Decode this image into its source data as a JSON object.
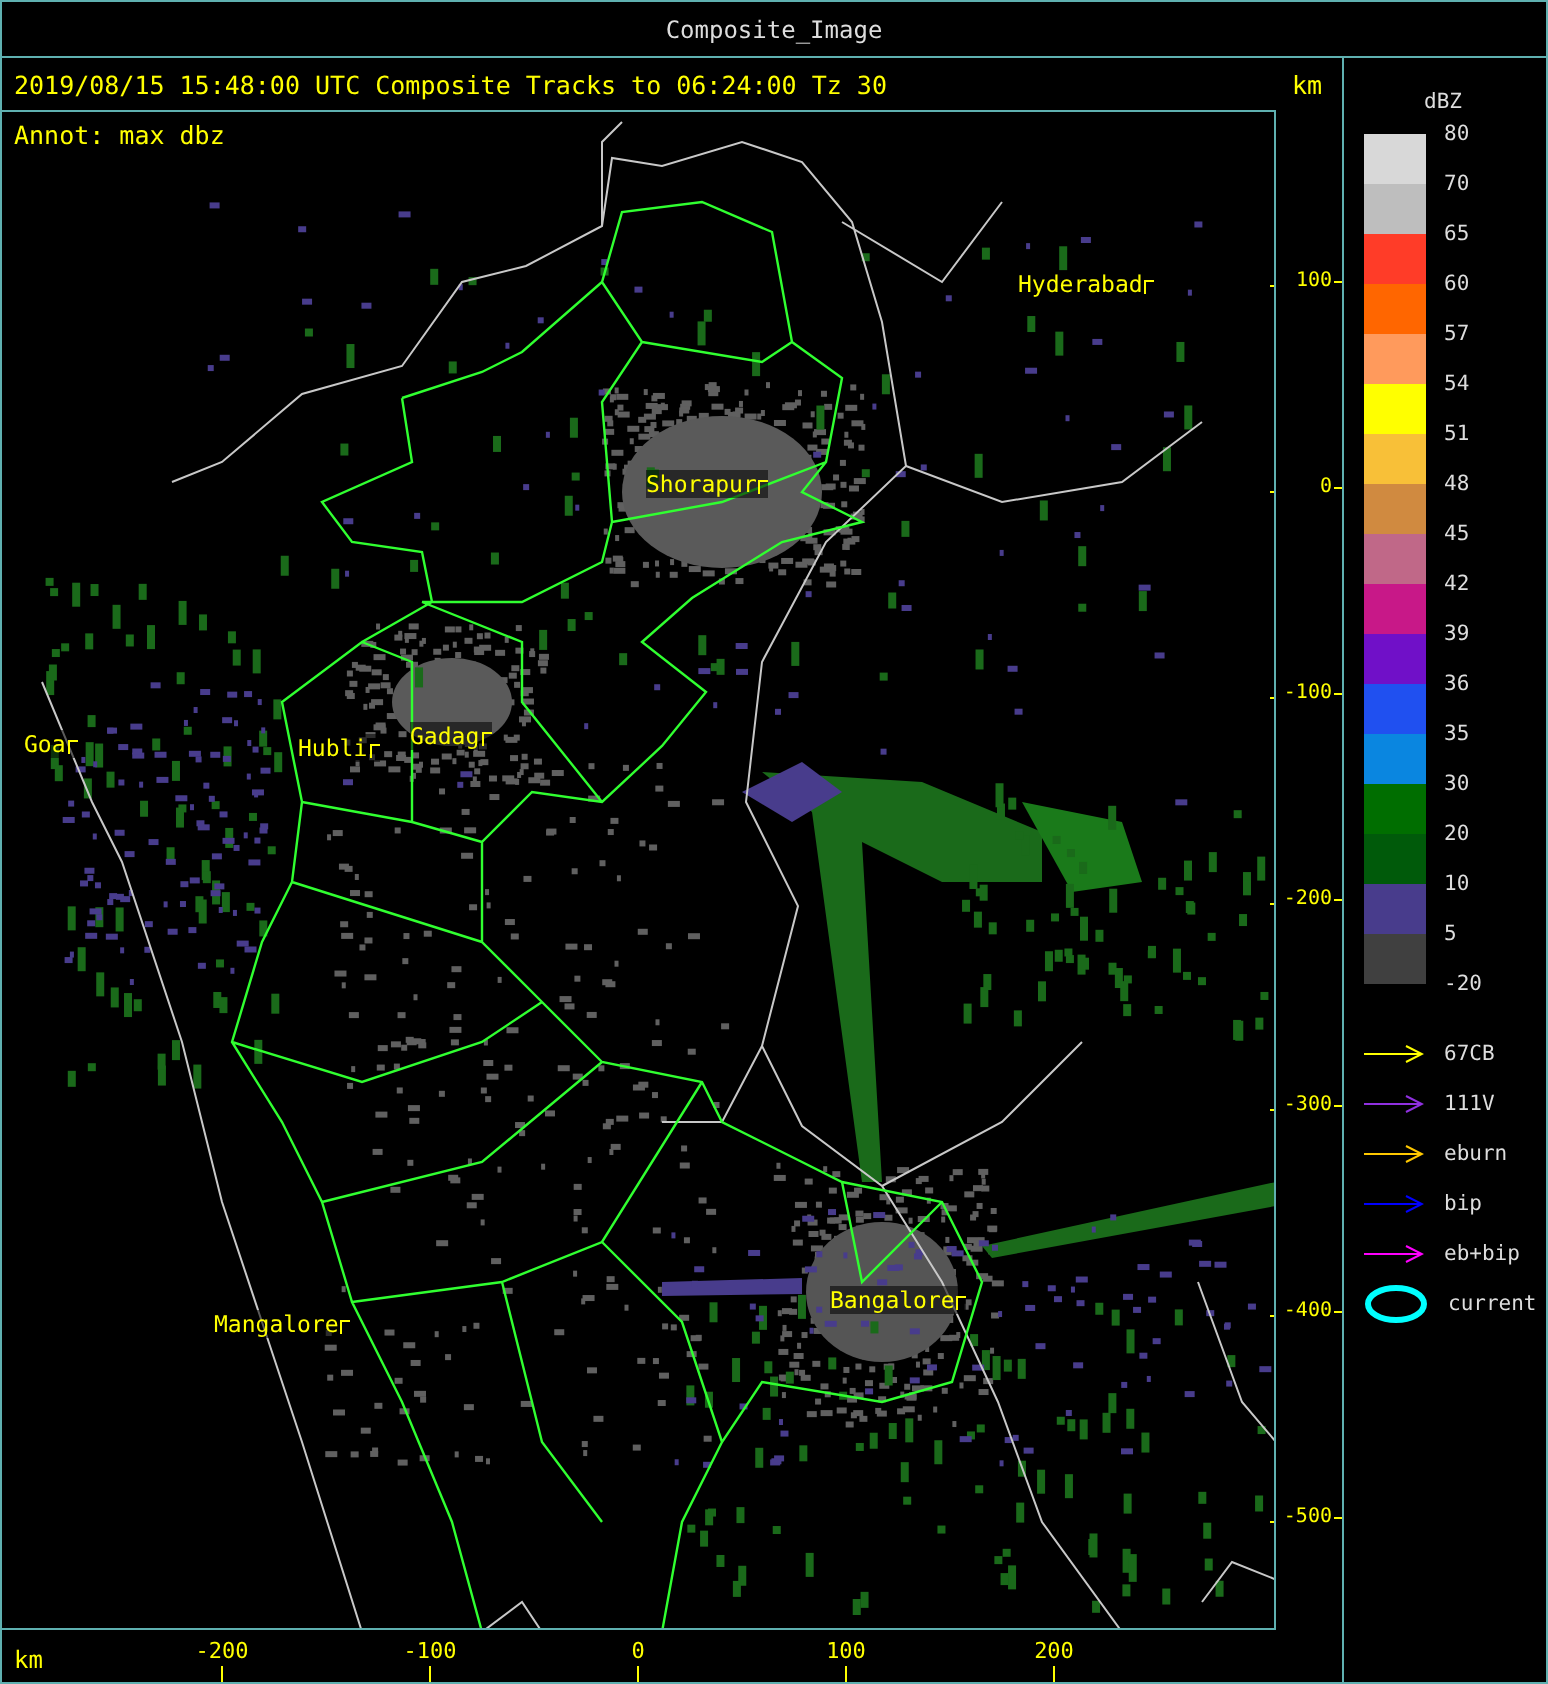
{
  "window": {
    "title": "Composite_Image"
  },
  "header": {
    "caption": "2019/08/15 15:48:00 UTC Composite Tracks to 06:24:00 Tz 30",
    "unit": "km"
  },
  "map": {
    "annotation": "Annot: max dbz",
    "cities": [
      {
        "name": "Hyderabad"
      },
      {
        "name": "Shorapur"
      },
      {
        "name": "Goa"
      },
      {
        "name": "Hubli"
      },
      {
        "name": "Gadag"
      },
      {
        "name": "Mangalore"
      },
      {
        "name": "Bangalore"
      }
    ]
  },
  "y_axis": {
    "ticks": [
      "100",
      "0",
      "-100",
      "-200",
      "-300",
      "-400",
      "-500"
    ]
  },
  "x_axis": {
    "unit": "km",
    "ticks": [
      "-200",
      "-100",
      "0",
      "100",
      "200"
    ]
  },
  "legend": {
    "title": "dBZ",
    "bands": [
      {
        "color": "#d8d8d8"
      },
      {
        "color": "#bebebe"
      },
      {
        "color": "#ff3c28"
      },
      {
        "color": "#ff6600"
      },
      {
        "color": "#ff9a5c"
      },
      {
        "color": "#ffff00"
      },
      {
        "color": "#f8c038"
      },
      {
        "color": "#d08a40"
      },
      {
        "color": "#c06888"
      },
      {
        "color": "#c81888"
      },
      {
        "color": "#7010c8"
      },
      {
        "color": "#2050f0"
      },
      {
        "color": "#0a86e0"
      },
      {
        "color": "#006e00"
      },
      {
        "color": "#005a0a"
      },
      {
        "color": "#483c8c"
      },
      {
        "color": "#404040"
      }
    ],
    "labels": [
      "80",
      "70",
      "65",
      "60",
      "57",
      "54",
      "51",
      "48",
      "45",
      "42",
      "39",
      "36",
      "35",
      "30",
      "20",
      "10",
      "5",
      "-20"
    ],
    "tracks": [
      {
        "label": "67CB",
        "color": "#ffff00"
      },
      {
        "label": "111V",
        "color": "#9030e0"
      },
      {
        "label": "eburn",
        "color": "#ffc800"
      },
      {
        "label": "bip",
        "color": "#0000ff"
      },
      {
        "label": "eb+bip",
        "color": "#ff00ff"
      }
    ],
    "current": "current"
  }
}
